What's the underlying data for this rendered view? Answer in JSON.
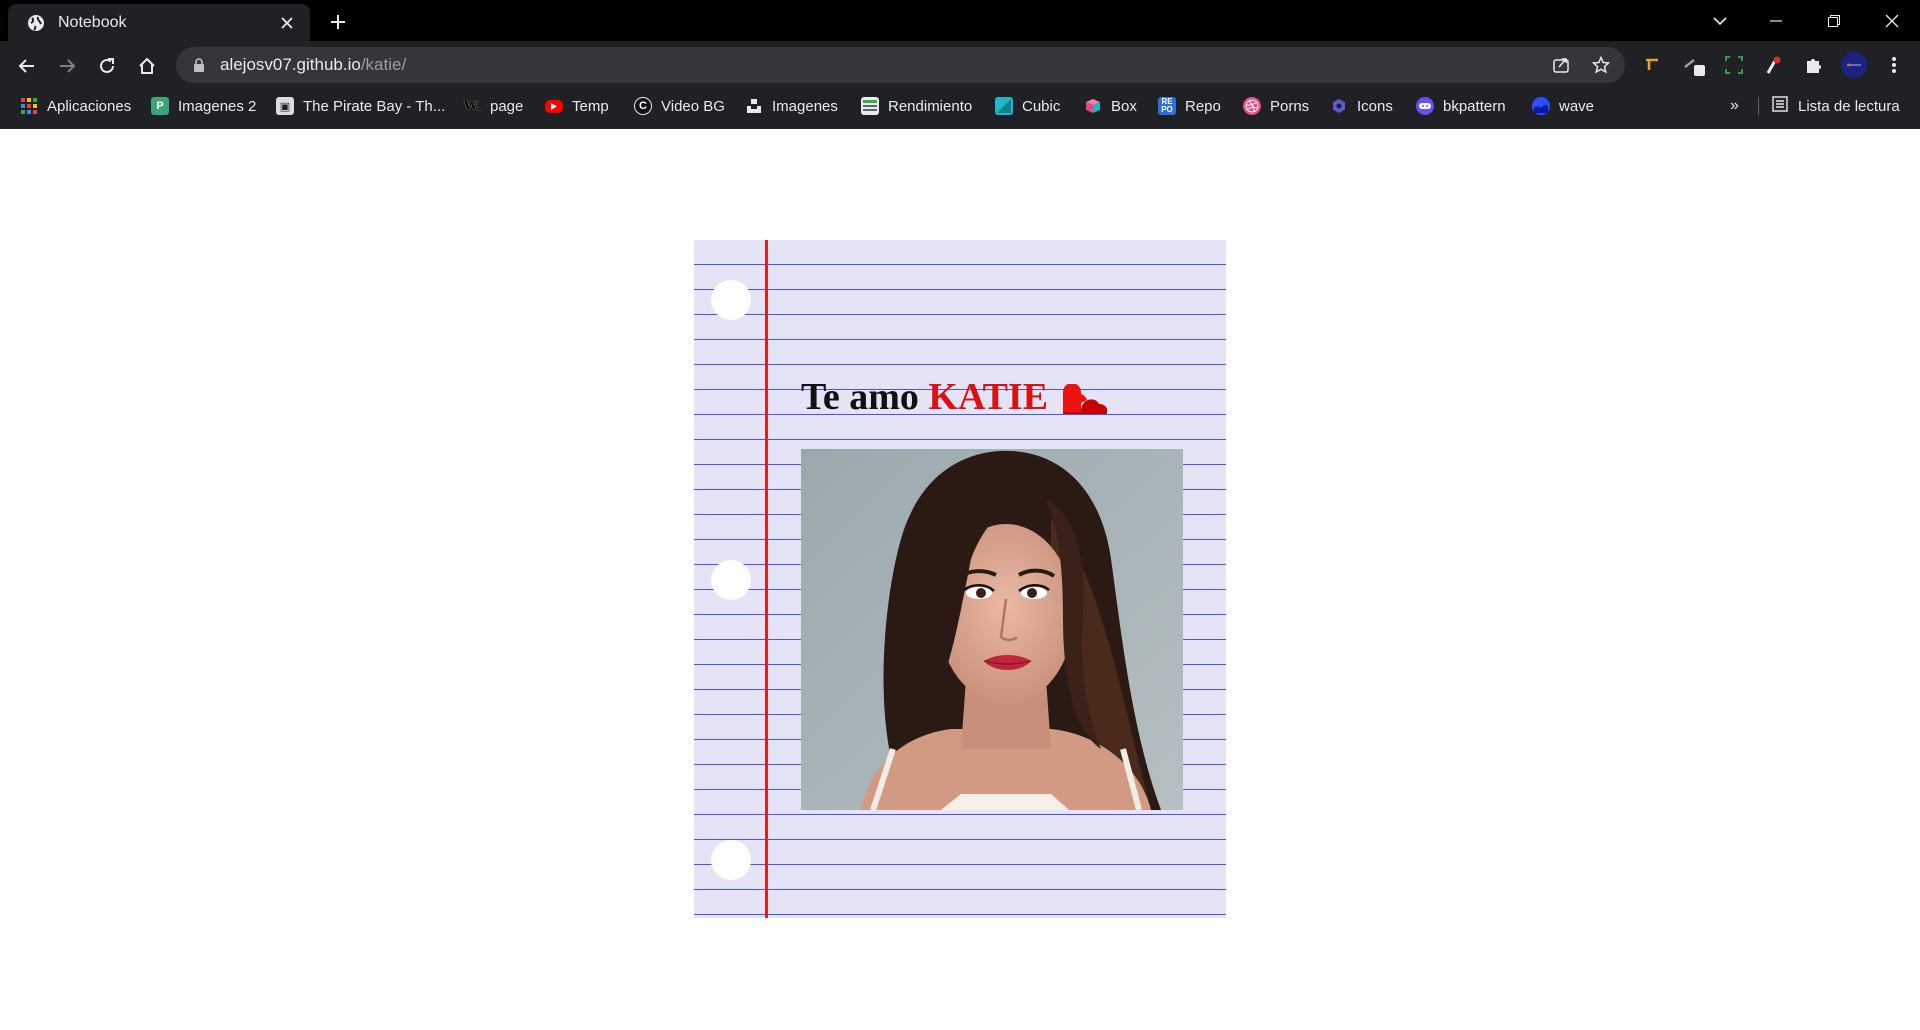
{
  "browser": {
    "tab": {
      "title": "Notebook"
    },
    "url": {
      "host": "alejosv07.github.io",
      "path": "/katie/"
    }
  },
  "bookmarks": [
    {
      "label": "Aplicaciones",
      "icon": "apps-grid-icon",
      "color": "#ea4335"
    },
    {
      "label": "Imagenes 2",
      "icon": "image-p-icon",
      "color": "#3aa57a"
    },
    {
      "label": "The Pirate Bay - Th...",
      "icon": "pirate-bay-icon",
      "color": "#dadce0"
    },
    {
      "label": "page",
      "icon": "w-letter-icon",
      "color": "#000000"
    },
    {
      "label": "Temp",
      "icon": "youtube-icon",
      "color": "#ff0000"
    },
    {
      "label": "Video BG",
      "icon": "c-circle-icon",
      "color": "#111111"
    },
    {
      "label": "Imagenes",
      "icon": "unsplash-icon",
      "color": "#000000"
    },
    {
      "label": "Rendimiento",
      "icon": "spreadsheet-icon",
      "color": "#34a853"
    },
    {
      "label": "Cubic",
      "icon": "cubic-icon",
      "color": "#1fb6c9"
    },
    {
      "label": "Box",
      "icon": "box-cube-icon",
      "color": "#e8467c"
    },
    {
      "label": "Repo",
      "icon": "repo-icon",
      "color": "#2f6fdc"
    },
    {
      "label": "Porns",
      "icon": "dribbble-icon",
      "color": "#ea4c89"
    },
    {
      "label": "Icons",
      "icon": "hexagon-icon",
      "color": "#5b5bd6"
    },
    {
      "label": "bkpattern",
      "icon": "bkpattern-icon",
      "color": "#6b4bff"
    },
    {
      "label": "wave",
      "icon": "wave-icon",
      "color": "#2f4dff"
    }
  ],
  "bookmarks_more": "»",
  "reading_list": "Lista de lectura",
  "content": {
    "headline_prefix": "Te amo",
    "headline_name": "KATIE",
    "photo_alt": "photo-of-katie",
    "colors": {
      "paper": "#e4e4f6",
      "rule_line": "#4a56d6",
      "margin_line": "#dd2222",
      "name": "#dd1111"
    }
  }
}
